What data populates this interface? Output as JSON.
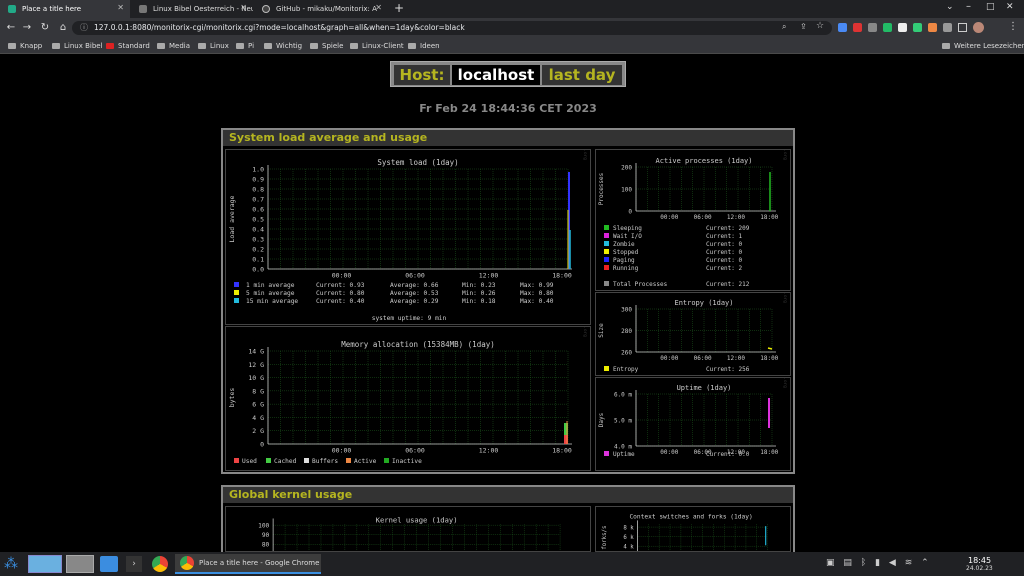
{
  "tabs": [
    {
      "title": "Place a title here",
      "active": true
    },
    {
      "title": "Linux Bibel Oesterreich - Neu"
    },
    {
      "title": "GitHub - mikaku/Monitorix: A"
    }
  ],
  "address": {
    "url": "127.0.0.1:8080/monitorix-cgi/monitorix.cgi?mode=localhost&graph=all&when=1day&color=black"
  },
  "bookmarks": [
    "Knapp",
    "Linux Bibel",
    "Standard",
    "Media",
    "Linux",
    "Pi",
    "Wichtig",
    "Spiele",
    "Linux-Client",
    "Ideen"
  ],
  "other_bookmarks": "Weitere Lesezeichen",
  "header": {
    "host_label": "Host:",
    "host": "localhost",
    "period": "last day",
    "datetime": "Fr Feb 24 18:44:36 CET 2023"
  },
  "sections": {
    "system": "System load average and usage",
    "kernel": "Global kernel usage"
  },
  "side_label": "Monitorix - www.monitorix.org",
  "load": {
    "title": "System load  (1day)",
    "ylabel": "Load average",
    "yticks": [
      "1.0",
      "0.9",
      "0.8",
      "0.7",
      "0.6",
      "0.5",
      "0.4",
      "0.3",
      "0.2",
      "0.1",
      "0.0"
    ],
    "xticks": [
      "00:00",
      "06:00",
      "12:00",
      "18:00"
    ],
    "legend": [
      {
        "name": "1 min average",
        "color": "#3333ff",
        "current": "Current: 0.93",
        "average": "Average: 0.66",
        "min": "Min: 0.23",
        "max": "Max: 0.99"
      },
      {
        "name": "5 min average",
        "color": "#eeee00",
        "current": "Current: 0.80",
        "average": "Average: 0.53",
        "min": "Min: 0.26",
        "max": "Max: 0.80"
      },
      {
        "name": "15 min average",
        "color": "#22bbdd",
        "current": "Current: 0.40",
        "average": "Average: 0.29",
        "min": "Min: 0.18",
        "max": "Max: 0.40"
      }
    ],
    "uptime": "system uptime:  9 min"
  },
  "memory": {
    "title": "Memory allocation (15384MB)  (1day)",
    "ylabel": "bytes",
    "yticks": [
      "14 G",
      "12 G",
      "10 G",
      "8 G",
      "6 G",
      "4 G",
      "2 G",
      "0"
    ],
    "xticks": [
      "00:00",
      "06:00",
      "12:00",
      "18:00"
    ],
    "legend": [
      {
        "name": "Used",
        "color": "#ee4444"
      },
      {
        "name": "Cached",
        "color": "#44cc44"
      },
      {
        "name": "Buffers",
        "color": "#dddddd"
      },
      {
        "name": "Active",
        "color": "#ee8844"
      },
      {
        "name": "Inactive",
        "color": "#22aa22"
      }
    ]
  },
  "processes": {
    "title": "Active processes  (1day)",
    "ylabel": "Processes",
    "yticks": [
      "200",
      "100",
      "0"
    ],
    "xticks": [
      "00:00",
      "06:00",
      "12:00",
      "18:00"
    ],
    "legend": [
      {
        "name": "Sleeping",
        "color": "#22bb22",
        "current": "Current:  209"
      },
      {
        "name": "Wait I/O",
        "color": "#dd22dd",
        "current": "Current:    1"
      },
      {
        "name": "Zombie",
        "color": "#22bbdd",
        "current": "Current:    0"
      },
      {
        "name": "Stopped",
        "color": "#eeee00",
        "current": "Current:    0"
      },
      {
        "name": "Paging",
        "color": "#2222ff",
        "current": "Current:    0"
      },
      {
        "name": "Running",
        "color": "#ee2222",
        "current": "Current:    2"
      }
    ],
    "total": {
      "name": "Total Processes",
      "color": "#888888",
      "current": "Current:  212"
    }
  },
  "entropy": {
    "title": "Entropy  (1day)",
    "ylabel": "Size",
    "yticks": [
      "300",
      "280",
      "260"
    ],
    "xticks": [
      "00:00",
      "06:00",
      "12:00",
      "18:00"
    ],
    "legend": {
      "name": "Entropy",
      "color": "#eeee00",
      "current": "Current:   256"
    }
  },
  "uptime": {
    "title": "Uptime  (1day)",
    "ylabel": "Days",
    "yticks": [
      "6.0 m",
      "5.0 m",
      "4.0 m"
    ],
    "xticks": [
      "00:00",
      "06:00",
      "12:00",
      "18:00"
    ],
    "legend": {
      "name": "Uptime",
      "color": "#dd33dd",
      "current": "Current:   0.0"
    }
  },
  "kernel_usage": {
    "title": "Kernel usage  (1day)",
    "yticks": [
      "100",
      "90",
      "80"
    ]
  },
  "ctx": {
    "title": "Context switches and forks  (1day)",
    "ylabel": "forks/s",
    "yticks": [
      "8 k",
      "6 k",
      "4 k"
    ]
  },
  "taskbar": {
    "window_title": "Place a title here - Google Chrome",
    "time": "18:45",
    "date": "24.02.23"
  },
  "colors": {
    "olive": "#b5b520",
    "grid": "#1e5a1e"
  }
}
